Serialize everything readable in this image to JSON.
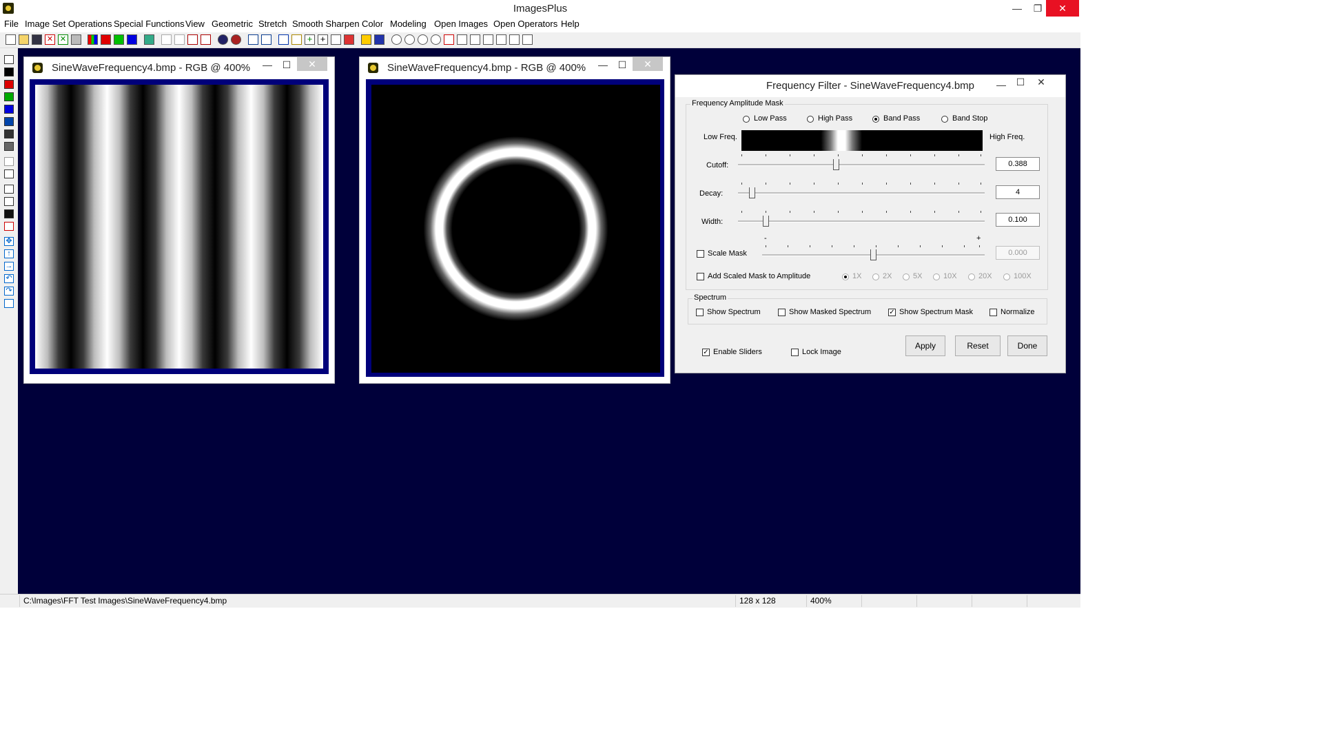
{
  "app": {
    "title": "ImagesPlus",
    "minimize_glyph": "—",
    "restore_glyph": "❐",
    "close_glyph": "✕"
  },
  "menu": [
    "File",
    "Image Set Operations",
    "Special Functions",
    "View",
    "Geometric",
    "Stretch",
    "Smooth Sharpen",
    "Color",
    "Modeling",
    "Open Images",
    "Open Operators",
    "Help"
  ],
  "windows": [
    {
      "title": "SineWaveFrequency4.bmp - RGB @ 400%",
      "minimize": "—",
      "maximize": "☐",
      "close": "✕"
    },
    {
      "title": "SineWaveFrequency4.bmp - RGB @ 400%",
      "minimize": "—",
      "maximize": "☐",
      "close": "✕"
    }
  ],
  "dialog": {
    "title": "Frequency Filter - SineWaveFrequency4.bmp",
    "minimize": "—",
    "maximize": "☐",
    "close": "✕",
    "mask_group": {
      "label": "Frequency Amplitude Mask",
      "filters": [
        {
          "label": "Low Pass",
          "selected": false
        },
        {
          "label": "High Pass",
          "selected": false
        },
        {
          "label": "Band Pass",
          "selected": true
        },
        {
          "label": "Band Stop",
          "selected": false
        }
      ],
      "low_freq_label": "Low Freq.",
      "high_freq_label": "High Freq.",
      "cutoff": {
        "label": "Cutoff:",
        "value": "0.388"
      },
      "decay": {
        "label": "Decay:",
        "value": "4"
      },
      "width": {
        "label": "Width:",
        "value": "0.100"
      },
      "scale_mask": {
        "label": "Scale Mask",
        "checked": false,
        "value": "0.000",
        "min_mark": "-",
        "max_mark": "+"
      },
      "add_scaled": {
        "label": "Add Scaled Mask to Amplitude",
        "checked": false
      },
      "multipliers": [
        "1X",
        "2X",
        "5X",
        "10X",
        "20X",
        "100X"
      ]
    },
    "spectrum_group": {
      "label": "Spectrum",
      "show_spectrum": {
        "label": "Show Spectrum",
        "checked": false
      },
      "show_masked": {
        "label": "Show Masked Spectrum",
        "checked": false
      },
      "show_mask": {
        "label": "Show Spectrum Mask",
        "checked": true
      },
      "normalize": {
        "label": "Normalize",
        "checked": false
      }
    },
    "enable_sliders": {
      "label": "Enable Sliders",
      "checked": true
    },
    "lock_image": {
      "label": "Lock Image",
      "checked": false
    },
    "apply_label": "Apply",
    "reset_label": "Reset",
    "done_label": "Done",
    "check_glyph": "✓"
  },
  "status": {
    "path": "C:\\Images\\FFT Test Images\\SineWaveFrequency4.bmp",
    "size": "128 x 128",
    "zoom": "400%"
  },
  "colors": {
    "workspace": "#00003a",
    "image_frame": "#00007a",
    "app_close": "#e81123",
    "toolbar_red": "#e00000",
    "toolbar_green": "#00c000",
    "toolbar_blue": "#0000e0"
  }
}
